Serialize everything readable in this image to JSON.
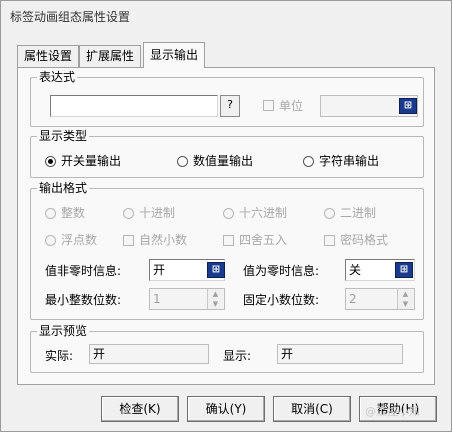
{
  "window": {
    "title": "标签动画组态属性设置"
  },
  "tabs": [
    {
      "label": "属性设置",
      "active": false
    },
    {
      "label": "扩展属性",
      "active": false
    },
    {
      "label": "显示输出",
      "active": true
    }
  ],
  "expression": {
    "title": "表达式",
    "value": "",
    "query_label": "?",
    "unit_label": "单位",
    "unit_checked": false,
    "unit_value": "",
    "picker_icon": "table-picker-icon"
  },
  "display_type": {
    "title": "显示类型",
    "options": [
      {
        "label": "开关量输出",
        "selected": true
      },
      {
        "label": "数值量输出",
        "selected": false
      },
      {
        "label": "字符串输出",
        "selected": false
      }
    ]
  },
  "output_format": {
    "title": "输出格式",
    "radix": [
      "整数",
      "十进制",
      "十六进制",
      "二进制"
    ],
    "float_label": "浮点数",
    "checks": [
      "自然小数",
      "四舍五入",
      "密码格式"
    ],
    "nonzero_label": "值非零时信息:",
    "nonzero_value": "开",
    "zero_label": "值为零时信息:",
    "zero_value": "关",
    "min_int_label": "最小整数位数:",
    "min_int_value": "1",
    "fixed_dec_label": "固定小数位数:",
    "fixed_dec_value": "2"
  },
  "preview": {
    "title": "显示预览",
    "actual_label": "实际:",
    "actual_value": "开",
    "display_label": "显示:",
    "display_value": "开"
  },
  "buttons": {
    "check": "检查(K)",
    "confirm": "确认(Y)",
    "cancel": "取消(C)",
    "help": "帮助(H)"
  },
  "watermark": "@工控小知"
}
